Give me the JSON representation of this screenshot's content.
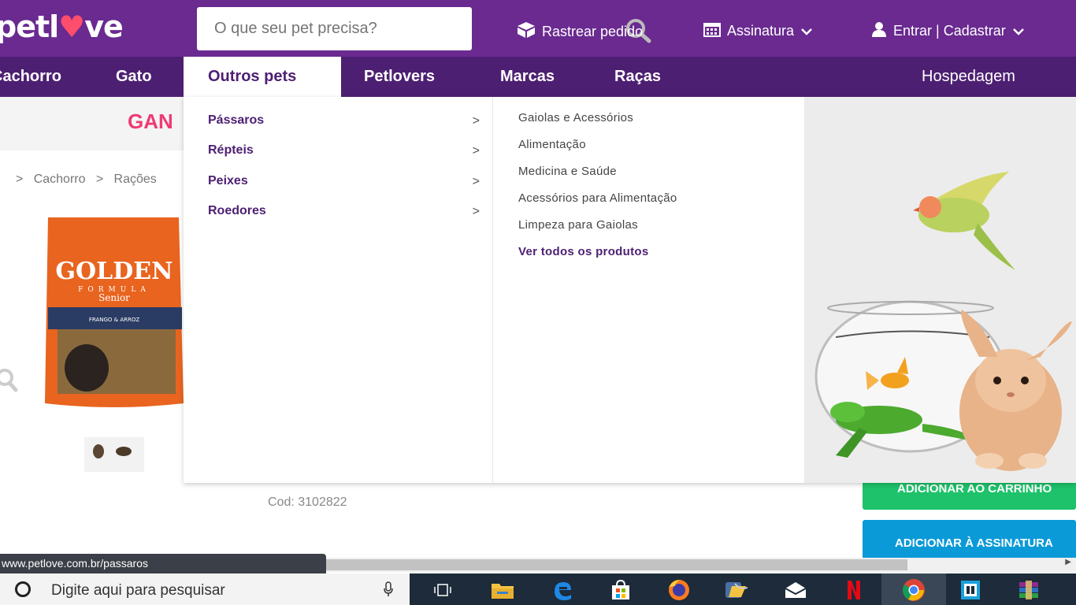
{
  "header": {
    "logo_text": "petlove",
    "search_placeholder": "O que seu pet precisa?",
    "track_order": "Rastrear pedido",
    "subscription": "Assinatura",
    "login": "Entrar | Cadastrar"
  },
  "nav": {
    "items": [
      "Cachorro",
      "Gato",
      "Outros pets",
      "Petlovers",
      "Marcas",
      "Raças"
    ],
    "right": "Hospedagem",
    "active": "Outros pets"
  },
  "promo": {
    "text": "GAN"
  },
  "breadcrumb": {
    "items": [
      "Cachorro",
      "Rações"
    ]
  },
  "product": {
    "brand": "GOLDEN",
    "line": "FORMULA",
    "variant": "Senior",
    "flavor": "FRANGO & ARROZ",
    "code": "Cod: 3102822"
  },
  "dropdown": {
    "categories": [
      "Pássaros",
      "Répteis",
      "Peixes",
      "Roedores"
    ],
    "subitems": [
      "Gaiolas e Acessórios",
      "Alimentação",
      "Medicina e Saúde",
      "Acessórios para Alimentação",
      "Limpeza para Gaiolas"
    ],
    "view_all": "Ver todos os produtos"
  },
  "buttons": {
    "add_cart": "ADICIONAR AO CARRINHO",
    "add_subscription": "ADICIONAR À ASSINATURA"
  },
  "status_bar": {
    "url": "www.petlove.com.br/passaros"
  },
  "taskbar": {
    "search_placeholder": "Digite aqui para pesquisar"
  },
  "colors": {
    "brand": "#6a2a90",
    "nav": "#4d1f72",
    "accent_pink": "#ee3a74",
    "cart_green": "#1ec26a",
    "sub_blue": "#0b9ad8"
  }
}
